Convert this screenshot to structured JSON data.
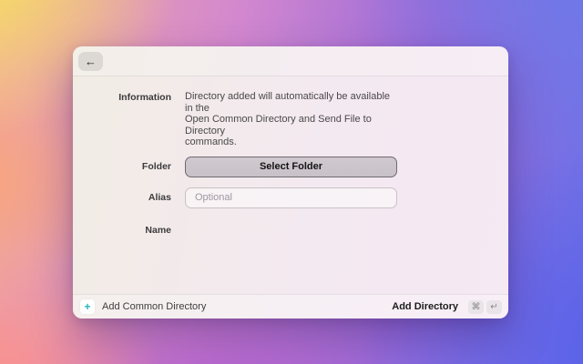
{
  "window": {
    "header": {
      "back_icon": "←"
    },
    "form": {
      "information": {
        "label": "Information",
        "lines": [
          "Directory added will automatically be available in the",
          "Open Common Directory and Send File to Directory",
          "commands."
        ]
      },
      "folder": {
        "label": "Folder",
        "button_label": "Select Folder"
      },
      "alias": {
        "label": "Alias",
        "value": "",
        "placeholder": "Optional"
      },
      "name": {
        "label": "Name",
        "value": ""
      }
    },
    "footer": {
      "plus_icon": "+",
      "add_common_label": "Add Common Directory",
      "add_directory_label": "Add Directory",
      "shortcut_command": "⌘",
      "shortcut_return": "↵"
    }
  },
  "colors": {
    "accent_teal": "#29b4bf",
    "button_border": "#6e6a70",
    "background_corners": {
      "top_left": "#f6e25e",
      "bottom_left": "#fa8f8c",
      "top_middle": "#d287cf",
      "bottom_middle": "#ac55cd",
      "top_right": "#6d7ae9",
      "bottom_right": "#5a60e8"
    }
  }
}
